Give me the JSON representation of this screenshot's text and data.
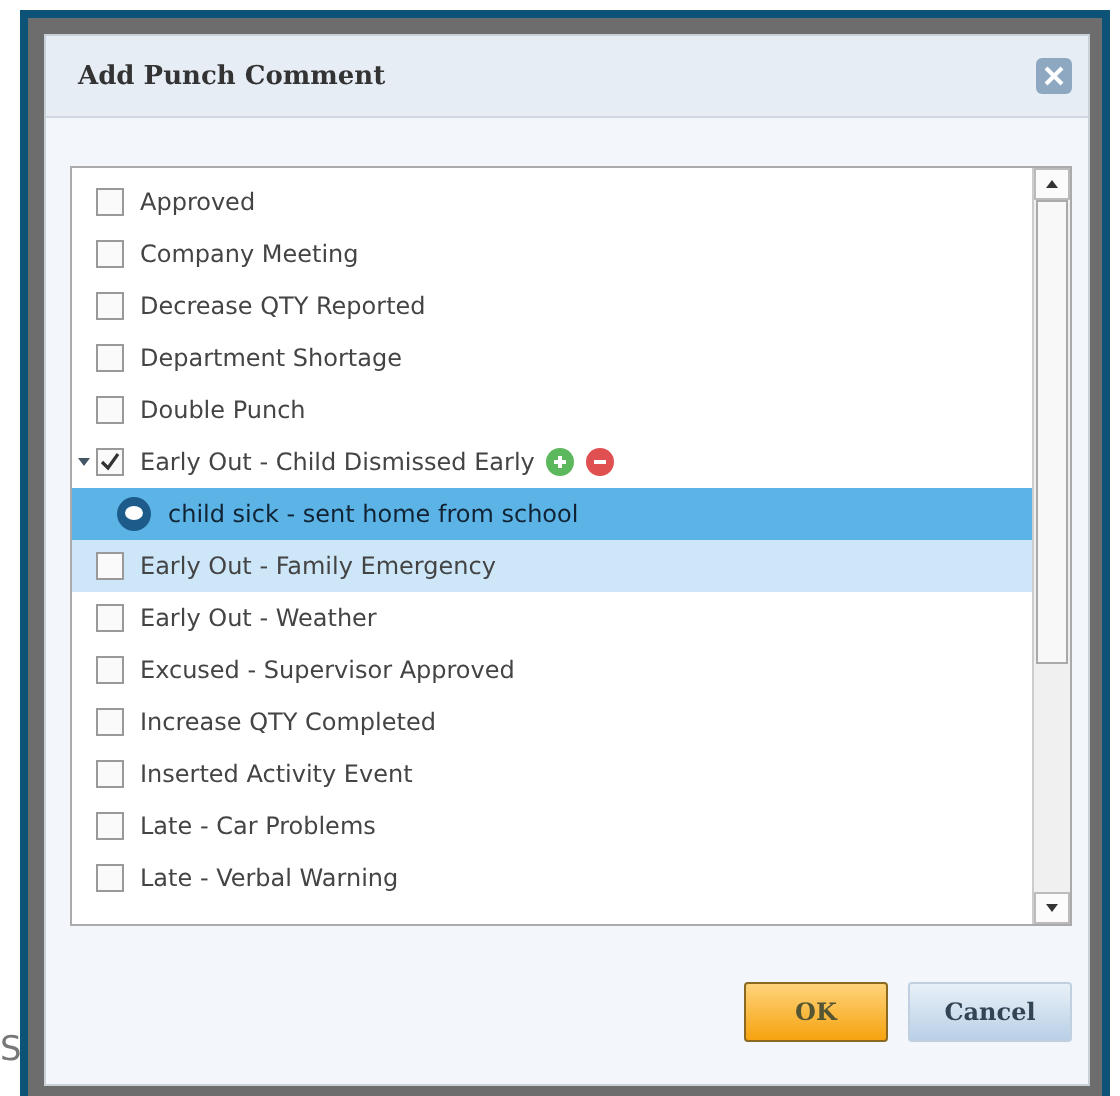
{
  "background": {
    "text": "S"
  },
  "dialog": {
    "title": "Add Punch Comment"
  },
  "items": [
    {
      "label": "Approved",
      "checked": false,
      "selected": false
    },
    {
      "label": "Company Meeting",
      "checked": false,
      "selected": false
    },
    {
      "label": "Decrease QTY Reported",
      "checked": false,
      "selected": false
    },
    {
      "label": "Department Shortage",
      "checked": false,
      "selected": false
    },
    {
      "label": "Double Punch",
      "checked": false,
      "selected": false
    },
    {
      "label": "Early Out - Child Dismissed Early",
      "checked": true,
      "selected": false,
      "expanded": true,
      "children": [
        {
          "label": "child sick - sent home from school",
          "selected": true
        }
      ]
    },
    {
      "label": "Early Out - Family Emergency",
      "checked": false,
      "selected": true
    },
    {
      "label": "Early Out - Weather",
      "checked": false,
      "selected": false
    },
    {
      "label": "Excused - Supervisor Approved",
      "checked": false,
      "selected": false
    },
    {
      "label": "Increase QTY Completed",
      "checked": false,
      "selected": false
    },
    {
      "label": "Inserted Activity Event",
      "checked": false,
      "selected": false
    },
    {
      "label": "Late - Car Problems",
      "checked": false,
      "selected": false
    },
    {
      "label": "Late - Verbal Warning",
      "checked": false,
      "selected": false
    }
  ],
  "buttons": [
    {
      "label": "OK",
      "kind": "primary"
    },
    {
      "label": "Cancel",
      "kind": "secondary"
    }
  ]
}
